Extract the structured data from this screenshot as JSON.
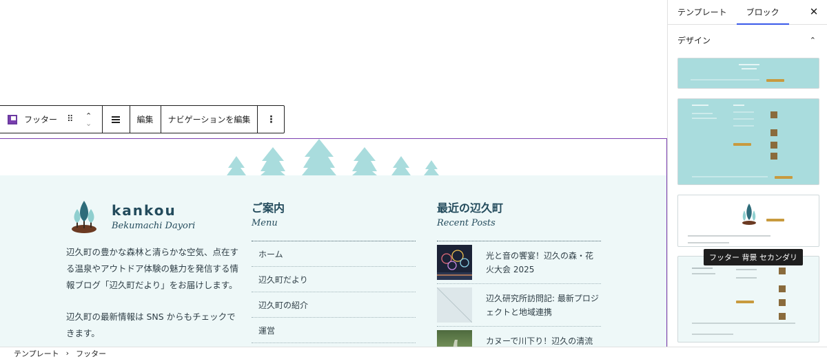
{
  "toolbar": {
    "block_label": "フッター",
    "edit_label": "編集",
    "edit_nav_label": "ナビゲーションを編集",
    "more_glyph": "⋮",
    "drag_glyph": "⠿",
    "move_up_glyph": "⌃",
    "move_down_glyph": "⌄"
  },
  "footer": {
    "brand": {
      "name": "kankou",
      "subtitle": "Bekumachi Dayori",
      "description": "辺久町の豊かな森林と清らかな空気、点在する温泉やアウトドア体験の魅力を発信する情報ブログ「辺久町だより」をお届けします。",
      "description2": "辺久町の最新情報は SNS からもチェックできます。"
    },
    "menu": {
      "title": "ご案内",
      "subtitle": "Menu",
      "items": [
        "ホーム",
        "辺久町だより",
        "辺久町の紹介",
        "運営"
      ]
    },
    "recent": {
      "title": "最近の辺久町",
      "subtitle": "Recent Posts",
      "items": [
        {
          "title": "光と音の饗宴！辺久の森・花火大会 2025",
          "thumb": "fireworks-image"
        },
        {
          "title": "辺久研究所訪問記: 最新プロジェクトと地域連携",
          "thumb": "placeholder-image"
        },
        {
          "title": "カヌーで川下り！辺久の清流を",
          "thumb": "river-image"
        }
      ]
    }
  },
  "sidebar": {
    "tabs": [
      "テンプレート",
      "ブロック"
    ],
    "active_tab": "ブロック",
    "close_glyph": "✕",
    "panel_title": "デザイン",
    "chevron_glyph": "⌃",
    "tooltip": "フッター 背景 セカンダリ"
  },
  "breadcrumb": {
    "items": [
      "テンプレート",
      "フッター"
    ],
    "separator": "›"
  },
  "colors": {
    "footer_bg": "#eef8f8",
    "tree": "#a9dcdd",
    "heading": "#234b5c",
    "accent": "#7b3fb0",
    "tab_active": "#3858e9"
  }
}
